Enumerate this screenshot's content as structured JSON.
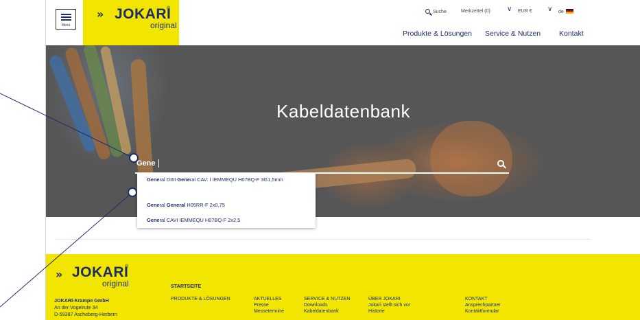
{
  "header": {
    "menu_label": "Menü",
    "logo": {
      "chevrons": "»",
      "word": "JOKARI",
      "reg": "®",
      "sub": "original"
    },
    "utility": {
      "search": "Suche",
      "memo": "Merkzettel (0)",
      "currency": "EUR €",
      "language": "de"
    },
    "nav": [
      "Produkte & Lösungen",
      "Service & Nutzen",
      "Kontakt"
    ]
  },
  "hero": {
    "title": "Kabeldatenbank",
    "search_value": "Gene"
  },
  "suggestions": [
    {
      "prefix": "Gene",
      "text": "ral DIIII ",
      "bold2": "Gene",
      "rest": "ral CAV: I IEMMEQU H07BQ-F 3G1,5mm"
    },
    {
      "prefix": "Gene",
      "text": "ral ",
      "bold2": "General",
      "rest": " H05RR-F 2x0,75"
    },
    {
      "prefix": "Gene",
      "text": "ral CAVI IEMMEQU H07BQ-F 2x2,5",
      "bold2": "",
      "rest": ""
    }
  ],
  "footer": {
    "logo": {
      "chevrons": "»",
      "word": "JOKARI",
      "reg": "®",
      "sub": "original"
    },
    "company": "JOKARI-Krampe GmbH",
    "address1": "An der Vogelrute 34",
    "address2": "D-59387 Ascheberg-Herbern",
    "startseite": "STARTSEITE",
    "columns": [
      {
        "heading": "PRODUKTE & LÖSUNGEN",
        "links": []
      },
      {
        "heading": "AKTUELLES",
        "links": [
          "Presse",
          "Messetermine"
        ]
      },
      {
        "heading": "SERVICE & NUTZEN",
        "links": [
          "Downloads",
          "Kabeldatenbank"
        ]
      },
      {
        "heading": "ÜBER JOKARI",
        "links": [
          "Jokari stellt sich vor",
          "Historie"
        ]
      },
      {
        "heading": "KONTAKT",
        "links": [
          "Ansprechpartner",
          "Kontaktformular"
        ]
      }
    ]
  },
  "colors": {
    "brand_yellow": "#f2e600",
    "brand_navy": "#1d2d6b",
    "hero_gray": "#565656"
  }
}
